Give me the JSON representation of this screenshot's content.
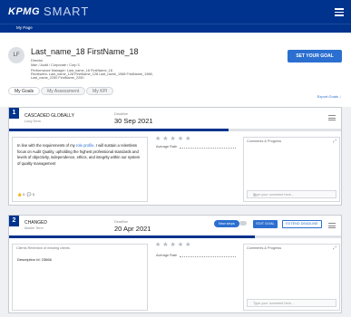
{
  "header": {
    "logo": "KPMG",
    "app_name": "SMART",
    "menu_icon": "hamburger-icon",
    "breadcrumb": "My Page"
  },
  "profile": {
    "initials": "LF",
    "name": "Last_name_18 FirstName_18",
    "title": "Director",
    "org": "Man / Audit / Corporate / Corp 3",
    "manager": "Performance Manager: Last_name_18 FirstName_18",
    "reviewers": "Reviewers: Last_name_128 FirstName_128 Last_name_1988 FirstName_1988,",
    "reviewers2": "Last_name_2250 FirstName_2250",
    "set_goal": "SET YOUR GOAL"
  },
  "tabs": [
    "My Goals",
    "My Assessment",
    "My KPI"
  ],
  "export_label": "Export Goals",
  "goals": [
    {
      "number": "1",
      "title": "CASCADED GLOBALLY",
      "term": "Long Term",
      "deadline_label": "Deadline",
      "deadline": "30 Sep 2021",
      "progress": 0.66,
      "text_a": "In line with the requirements of my ",
      "text_link": "role profile,",
      "text_b": " I will sustain a relentless focus on Audit Quality, upholding the highest professional standards and levels of objectivity, independence, ethics, and integrity within our system of quality management",
      "likes": "0",
      "comments": "0",
      "rating_stars": "★★★★★",
      "average_rate": "Average Rate",
      "comments_title": "Comments & Progress",
      "comment_placeholder": "Type your comment here..."
    },
    {
      "number": "2",
      "title": "CHANGED",
      "term": "Mobile Term",
      "deadline_label": "Deadline",
      "deadline": "20 Apr 2021",
      "progress": 0.74,
      "new_steps": "New steps",
      "edit_goal": "EDIT GOAL",
      "extend_deadline": "EXTEND DEADLINE",
      "goal_box_title": "Clients Retention of existing clients",
      "description": "Description Id: 23666",
      "likes": "0",
      "comments": "0",
      "rating_stars": "★★★★★",
      "average_rate": "Average Rate",
      "comments_title": "Comments & Progress",
      "comment_placeholder": "Type your comment here..."
    }
  ]
}
